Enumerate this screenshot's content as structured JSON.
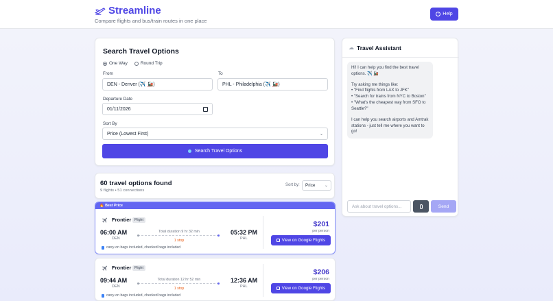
{
  "header": {
    "brand": "Streamline",
    "tagline": "Compare flights and bus/train routes in one place",
    "help_label": "Help",
    "help_icon": "?"
  },
  "search": {
    "title": "Search Travel Options",
    "trip_types": [
      "One Way",
      "Round Trip"
    ],
    "selected_trip": "One Way",
    "from_label": "From",
    "from_value": "DEN - Denver (✈️ 🚂)",
    "to_label": "To",
    "to_value": "PHL - Philadelphia (✈️ 🚂)",
    "departure_label": "Departure Date",
    "departure_value": "01/11/2026",
    "sortby_label": "Sort By",
    "sortby_value": "Price (Lowest First)",
    "search_button": "Search Travel Options"
  },
  "assistant": {
    "title": "Travel Assistant",
    "message_intro": "Hi! I can help you find the best travel options. ✈️ 🚂",
    "message_try": "Try asking me things like:",
    "examples": [
      "• \"Find flights from LAX to JFK\"",
      "• \"Search for trains from NYC to Boston\"",
      "• \"What's the cheapest way from SFO to Seattle?\""
    ],
    "message_outro": "I can help you search airports and Amtrak stations - just tell me where you want to go!",
    "input_placeholder": "Ask about travel options...",
    "send_label": "Send"
  },
  "results": {
    "title": "60 travel options found",
    "subtitle": "9 flights • 51 connections",
    "sort_label": "Sort by:",
    "sort_value": "Price",
    "best_price_label": "🔥 Best Price",
    "flights": [
      {
        "airline": "Frontier",
        "type": "Flight",
        "dep_time": "06:00 AM",
        "dep_code": "DEN",
        "arr_time": "05:32 PM",
        "arr_code": "PHL",
        "duration": "Total duration 9 hr 32 min",
        "stops": "1 stop",
        "bags": "carry-on bags included, checked bags included",
        "price": "$201",
        "per_person": "per person",
        "button": "View on Google Flights"
      },
      {
        "airline": "Frontier",
        "type": "Flight",
        "dep_time": "09:44 AM",
        "dep_code": "DEN",
        "arr_time": "12:36 AM",
        "arr_code": "PHL",
        "duration": "Total duration 12 hr 52 min",
        "stops": "1 stop",
        "bags": "carry-on bags included, checked bags included",
        "price": "$206",
        "per_person": "per person",
        "button": "View on Google Flights"
      }
    ]
  },
  "colors": {
    "accent": "#4f46e5",
    "best_strip": "#6366f1",
    "price": "#4338ca",
    "stops": "#ea580c"
  }
}
